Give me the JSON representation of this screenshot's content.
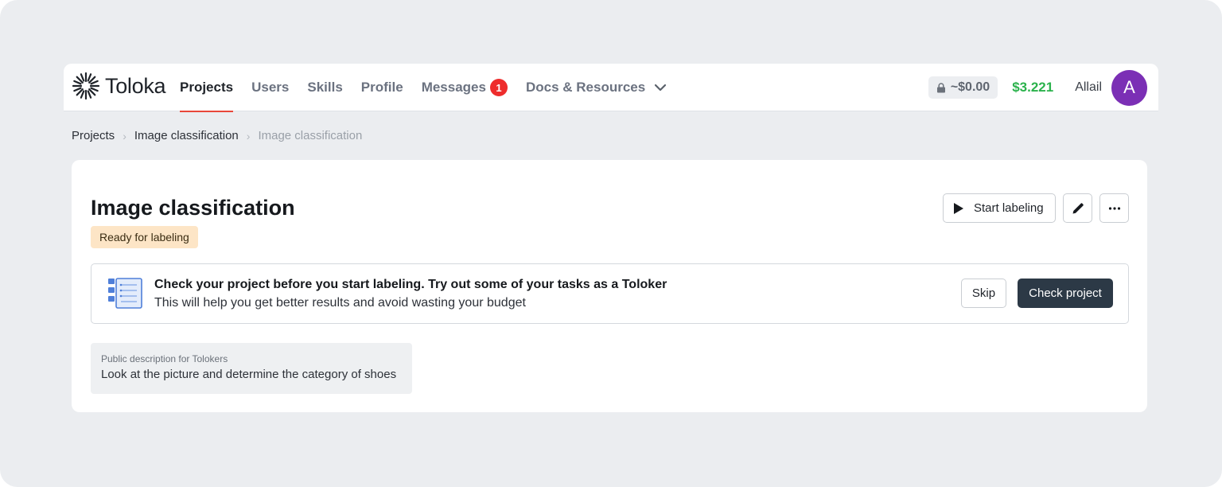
{
  "app": {
    "logo_text": "Toloka"
  },
  "nav": {
    "items": [
      {
        "label": "Projects"
      },
      {
        "label": "Users"
      },
      {
        "label": "Skills"
      },
      {
        "label": "Profile"
      },
      {
        "label": "Messages"
      },
      {
        "label": "Docs & Resources"
      }
    ],
    "messages_badge": "1",
    "active": "Projects"
  },
  "account": {
    "locked_amount": "~$0.00",
    "balance": "$3.221",
    "username": "Allail",
    "avatar_letter": "A"
  },
  "breadcrumb": {
    "items": [
      "Projects",
      "Image classification",
      "Image classification"
    ]
  },
  "project": {
    "title": "Image classification",
    "status": "Ready for labeling",
    "start_label": "Start labeling"
  },
  "banner": {
    "title": "Check your project before you start labeling. Try out some of your tasks as a Toloker",
    "subtitle": "This will help you get better results and avoid wasting your budget",
    "skip_label": "Skip",
    "check_label": "Check project"
  },
  "description": {
    "label": "Public description for Tolokers",
    "text": "Look at the picture and determine the category of shoes"
  },
  "colors": {
    "accent_red": "#e8473a",
    "balance_green": "#2bb24c",
    "avatar_purple": "#7b2fb5",
    "status_bg": "#fde5c6",
    "primary_button": "#2c3946"
  },
  "icons": {
    "logo": "toloka-burst-icon",
    "dropdown": "chevron-down-icon",
    "lock": "lock-icon",
    "play": "play-icon",
    "edit": "pencil-icon",
    "more": "more-dots-icon",
    "checklist": "checklist-icon"
  }
}
